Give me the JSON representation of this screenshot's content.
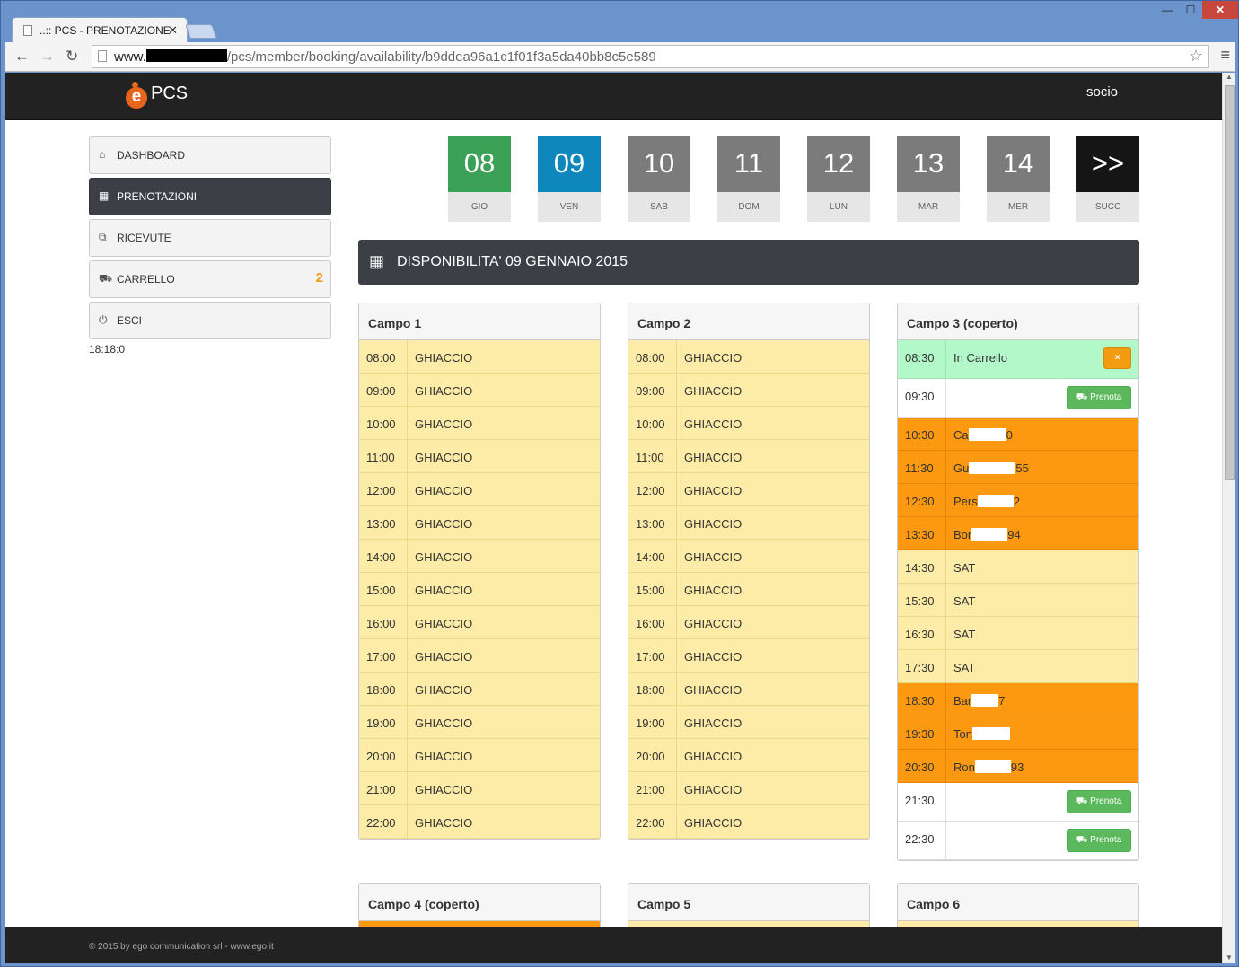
{
  "browser": {
    "tab_title": "..:: PCS - PRENOTAZIONE",
    "url_host": "www.",
    "url_path": "/pcs/member/booking/availability/b9ddea96a1c1f01f3a5da40bb8c5e589"
  },
  "header": {
    "brand": "PCS",
    "user": "socio"
  },
  "sidebar": {
    "items": [
      {
        "label": "DASHBOARD",
        "icon": "home-icon",
        "active": false
      },
      {
        "label": "PRENOTAZIONI",
        "icon": "calendar-icon",
        "active": true
      },
      {
        "label": "RICEVUTE",
        "icon": "receipt-icon",
        "active": false
      },
      {
        "label": "CARRELLO",
        "icon": "cart-icon",
        "active": false,
        "count": "2"
      },
      {
        "label": "ESCI",
        "icon": "power-icon",
        "active": false
      }
    ],
    "clock": "18:18:0"
  },
  "days": [
    {
      "num": "08",
      "lbl": "GIO",
      "color": "#3aa157"
    },
    {
      "num": "09",
      "lbl": "VEN",
      "color": "#0d87bc"
    },
    {
      "num": "10",
      "lbl": "SAB",
      "color": "#7b7b7b"
    },
    {
      "num": "11",
      "lbl": "DOM",
      "color": "#7b7b7b"
    },
    {
      "num": "12",
      "lbl": "LUN",
      "color": "#7b7b7b"
    },
    {
      "num": "13",
      "lbl": "MAR",
      "color": "#7b7b7b"
    },
    {
      "num": "14",
      "lbl": "MER",
      "color": "#7b7b7b"
    },
    {
      "num": ">>",
      "lbl": "SUCC",
      "color": "#151515"
    }
  ],
  "banner": "DISPONIBILITA' 09 GENNAIO 2015",
  "campo1": {
    "title": "Campo 1",
    "rows": [
      {
        "t": "08:00",
        "s": "GHIACCIO"
      },
      {
        "t": "09:00",
        "s": "GHIACCIO"
      },
      {
        "t": "10:00",
        "s": "GHIACCIO"
      },
      {
        "t": "11:00",
        "s": "GHIACCIO"
      },
      {
        "t": "12:00",
        "s": "GHIACCIO"
      },
      {
        "t": "13:00",
        "s": "GHIACCIO"
      },
      {
        "t": "14:00",
        "s": "GHIACCIO"
      },
      {
        "t": "15:00",
        "s": "GHIACCIO"
      },
      {
        "t": "16:00",
        "s": "GHIACCIO"
      },
      {
        "t": "17:00",
        "s": "GHIACCIO"
      },
      {
        "t": "18:00",
        "s": "GHIACCIO"
      },
      {
        "t": "19:00",
        "s": "GHIACCIO"
      },
      {
        "t": "20:00",
        "s": "GHIACCIO"
      },
      {
        "t": "21:00",
        "s": "GHIACCIO"
      },
      {
        "t": "22:00",
        "s": "GHIACCIO"
      }
    ]
  },
  "campo2": {
    "title": "Campo 2",
    "rows": [
      {
        "t": "08:00",
        "s": "GHIACCIO"
      },
      {
        "t": "09:00",
        "s": "GHIACCIO"
      },
      {
        "t": "10:00",
        "s": "GHIACCIO"
      },
      {
        "t": "11:00",
        "s": "GHIACCIO"
      },
      {
        "t": "12:00",
        "s": "GHIACCIO"
      },
      {
        "t": "13:00",
        "s": "GHIACCIO"
      },
      {
        "t": "14:00",
        "s": "GHIACCIO"
      },
      {
        "t": "15:00",
        "s": "GHIACCIO"
      },
      {
        "t": "16:00",
        "s": "GHIACCIO"
      },
      {
        "t": "17:00",
        "s": "GHIACCIO"
      },
      {
        "t": "18:00",
        "s": "GHIACCIO"
      },
      {
        "t": "19:00",
        "s": "GHIACCIO"
      },
      {
        "t": "20:00",
        "s": "GHIACCIO"
      },
      {
        "t": "21:00",
        "s": "GHIACCIO"
      },
      {
        "t": "22:00",
        "s": "GHIACCIO"
      }
    ]
  },
  "campo3": {
    "title": "Campo 3 (coperto)",
    "remove_label": "×",
    "book_label": "Prenota",
    "rows": [
      {
        "t": "08:30",
        "s": "In Carrello",
        "kind": "cart"
      },
      {
        "t": "09:30",
        "s": "",
        "kind": "free"
      },
      {
        "t": "10:30",
        "s": "Ca",
        "tail": "0",
        "kind": "busy"
      },
      {
        "t": "11:30",
        "s": "Gu",
        "tail": "55",
        "kind": "busy"
      },
      {
        "t": "12:30",
        "s": "Pers",
        "tail": "2",
        "kind": "busy"
      },
      {
        "t": "13:30",
        "s": "Bor",
        "tail": "94",
        "kind": "busy"
      },
      {
        "t": "14:30",
        "s": "SAT",
        "kind": "sat"
      },
      {
        "t": "15:30",
        "s": "SAT",
        "kind": "sat"
      },
      {
        "t": "16:30",
        "s": "SAT",
        "kind": "sat"
      },
      {
        "t": "17:30",
        "s": "SAT",
        "kind": "sat"
      },
      {
        "t": "18:30",
        "s": "Bar",
        "tail": "7",
        "kind": "busy"
      },
      {
        "t": "19:30",
        "s": "Ton",
        "tail": "",
        "kind": "busy"
      },
      {
        "t": "20:30",
        "s": "Ron",
        "tail": "93",
        "kind": "busy"
      },
      {
        "t": "21:30",
        "s": "",
        "kind": "free"
      },
      {
        "t": "22:30",
        "s": "",
        "kind": "free"
      }
    ]
  },
  "campo4": {
    "title": "Campo 4 (coperto)"
  },
  "campo5": {
    "title": "Campo 5"
  },
  "campo6": {
    "title": "Campo 6"
  },
  "footer": "© 2015 by ego communication srl - www.ego.it"
}
